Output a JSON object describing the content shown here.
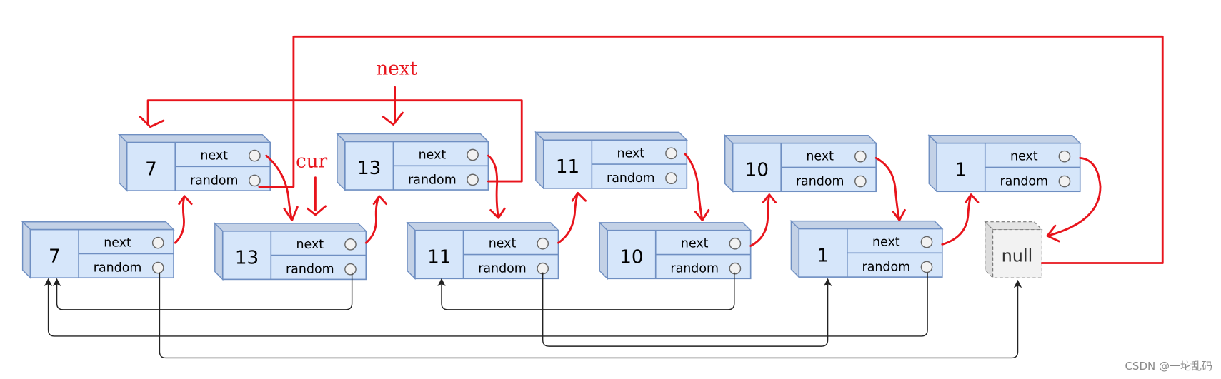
{
  "colors": {
    "node_fill": "#d6e6fa",
    "node_side": "#c3d1e6",
    "node_stroke": "#6f8fc2",
    "pointer": "#e8141c",
    "arrow": "#222222",
    "null_fill": "#f2f2f2"
  },
  "field_labels": {
    "next": "next",
    "random": "random"
  },
  "original_nodes": [
    {
      "value": "7"
    },
    {
      "value": "13"
    },
    {
      "value": "11"
    },
    {
      "value": "10"
    },
    {
      "value": "1"
    }
  ],
  "copied_nodes": [
    {
      "value": "7"
    },
    {
      "value": "13"
    },
    {
      "value": "11"
    },
    {
      "value": "10"
    },
    {
      "value": "1"
    }
  ],
  "null_node": {
    "label": "null"
  },
  "annotations": {
    "next_pointer": "next",
    "cur_pointer": "cur"
  },
  "watermark": "CSDN @一坨乱码"
}
